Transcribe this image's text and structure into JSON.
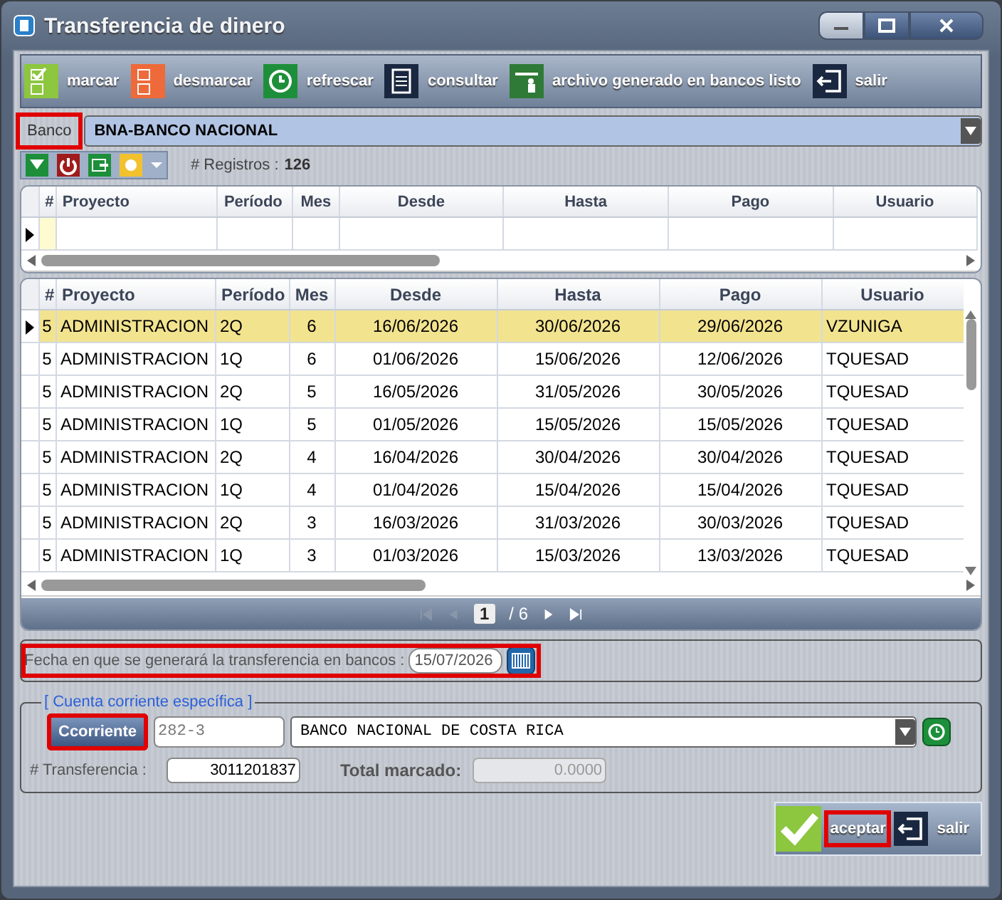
{
  "window": {
    "title": "Transferencia de dinero"
  },
  "toolbar": [
    {
      "kind": "mark",
      "label": "marcar"
    },
    {
      "kind": "unmark",
      "label": "desmarcar"
    },
    {
      "kind": "refresh",
      "label": "refrescar"
    },
    {
      "kind": "query",
      "label": "consultar"
    },
    {
      "kind": "done",
      "label": "archivo generado en bancos listo"
    },
    {
      "kind": "exit",
      "label": "salir"
    }
  ],
  "bank": {
    "label": "Banco",
    "highlighted": true,
    "value": "BNA-BANCO NACIONAL"
  },
  "records": {
    "label": "# Registros :",
    "value": "126"
  },
  "filter_columns": [
    "#",
    "Proyecto",
    "Período",
    "Mes",
    "Desde",
    "Hasta",
    "Pago",
    "Usuario"
  ],
  "columns": [
    "#",
    "Proyecto",
    "Período",
    "Mes",
    "Desde",
    "Hasta",
    "Pago",
    "Usuario"
  ],
  "rows": [
    {
      "selected": true,
      "cells": [
        "5",
        "ADMINISTRACION",
        "2Q",
        "6",
        "16/06/2026",
        "30/06/2026",
        "29/06/2026",
        "VZUNIGA"
      ]
    },
    {
      "selected": false,
      "cells": [
        "5",
        "ADMINISTRACION",
        "1Q",
        "6",
        "01/06/2026",
        "15/06/2026",
        "12/06/2026",
        "TQUESAD"
      ]
    },
    {
      "selected": false,
      "cells": [
        "5",
        "ADMINISTRACION",
        "2Q",
        "5",
        "16/05/2026",
        "31/05/2026",
        "30/05/2026",
        "TQUESAD"
      ]
    },
    {
      "selected": false,
      "cells": [
        "5",
        "ADMINISTRACION",
        "1Q",
        "5",
        "01/05/2026",
        "15/05/2026",
        "15/05/2026",
        "TQUESAD"
      ]
    },
    {
      "selected": false,
      "cells": [
        "5",
        "ADMINISTRACION",
        "2Q",
        "4",
        "16/04/2026",
        "30/04/2026",
        "30/04/2026",
        "TQUESAD"
      ]
    },
    {
      "selected": false,
      "cells": [
        "5",
        "ADMINISTRACION",
        "1Q",
        "4",
        "01/04/2026",
        "15/04/2026",
        "15/04/2026",
        "TQUESAD"
      ]
    },
    {
      "selected": false,
      "cells": [
        "5",
        "ADMINISTRACION",
        "2Q",
        "3",
        "16/03/2026",
        "31/03/2026",
        "30/03/2026",
        "TQUESAD"
      ]
    },
    {
      "selected": false,
      "cells": [
        "5",
        "ADMINISTRACION",
        "1Q",
        "3",
        "01/03/2026",
        "15/03/2026",
        "13/03/2026",
        "TQUESAD"
      ]
    }
  ],
  "pager": {
    "page": "1",
    "total": "/ 6"
  },
  "transfer_date": {
    "label": "Fecha en que se generará la transferencia en bancos :",
    "value": "15/07/2026",
    "highlighted": true
  },
  "account": {
    "legend": "[ Cuenta corriente específica ]",
    "button": "Ccorriente",
    "button_highlighted": true,
    "code": "282-3",
    "bank": "BANCO NACIONAL DE COSTA RICA",
    "transfer_label": "# Transferencia :",
    "transfer_value": "3011201837",
    "total_label": "Total marcado:",
    "total_value": "0.0000"
  },
  "footer": [
    {
      "kind": "accept",
      "label": "aceptar",
      "highlighted": true
    },
    {
      "kind": "exit",
      "label": "salir",
      "highlighted": false
    }
  ]
}
